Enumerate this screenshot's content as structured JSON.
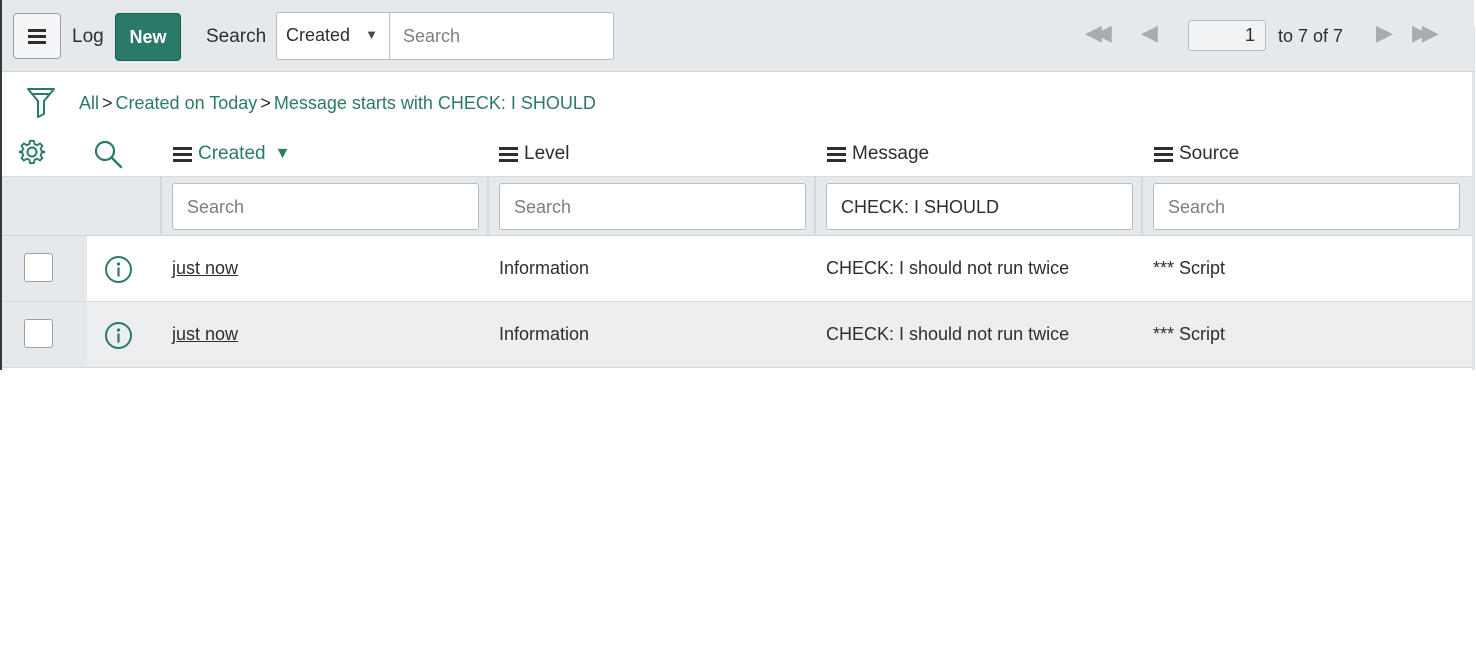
{
  "toolbar": {
    "title": "Log",
    "new_label": "New",
    "search_label": "Search",
    "search_field": "Created",
    "search_placeholder": "Search",
    "page": "1",
    "range_text": "to 7 of 7"
  },
  "breadcrumb": {
    "items": [
      "All",
      "Created on Today",
      "Message starts with CHECK: I SHOULD"
    ],
    "separator": ">"
  },
  "columns": [
    "Created",
    "Level",
    "Message",
    "Source"
  ],
  "sorted_column": "Created",
  "filters": {
    "created_placeholder": "Search",
    "level_placeholder": "Search",
    "message_value": "CHECK: I SHOULD",
    "source_placeholder": "Search"
  },
  "rows": [
    {
      "created": "just now",
      "level": "Information",
      "message": "CHECK: I should not run twice",
      "source": "*** Script"
    },
    {
      "created": "just now",
      "level": "Information",
      "message": "CHECK: I should not run twice",
      "source": "*** Script"
    }
  ],
  "colors": {
    "accent": "#2b7a69",
    "toolbar_bg": "#e6e9eb"
  },
  "icons": [
    "hamburger-icon",
    "filter-funnel-icon",
    "gear-icon",
    "search-icon",
    "info-icon",
    "first-page-icon",
    "prev-page-icon",
    "next-page-icon",
    "last-page-icon"
  ]
}
